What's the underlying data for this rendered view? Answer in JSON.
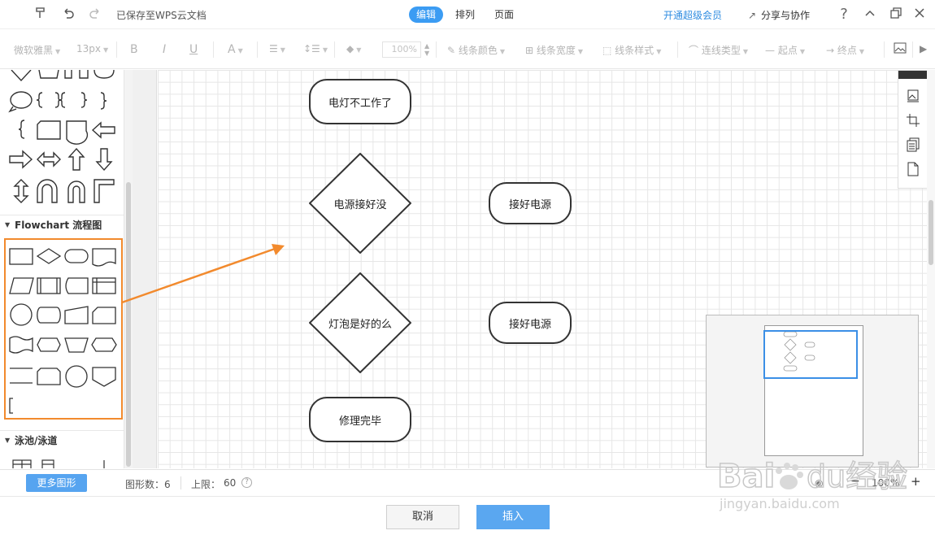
{
  "titlebar": {
    "saved_status": "已保存至WPS云文档",
    "tabs": [
      "编辑",
      "排列",
      "页面"
    ],
    "vip_link": "开通超级会员",
    "share": "分享与协作",
    "help": "?"
  },
  "toolbar": {
    "font_family": "微软雅黑",
    "font_size": "13px",
    "bold": "B",
    "italic": "I",
    "underline": "U",
    "font_color": "A",
    "zoom_value": "100%",
    "line_color": "线条颜色",
    "line_width": "线条宽度",
    "line_style": "线条样式",
    "connector_type": "连线类型",
    "start_point": "起点",
    "end_point": "终点"
  },
  "shape_panel": {
    "flowchart_header": "Flowchart 流程图",
    "swimlane_header": "泳池/泳道"
  },
  "canvas": {
    "nodes": {
      "n1": "电灯不工作了",
      "n2": "电源接好没",
      "n3": "接好电源",
      "n4": "灯泡是好的么",
      "n5": "接好电源",
      "n6": "修理完毕"
    }
  },
  "status": {
    "more_shapes": "更多图形",
    "shape_count_label": "图形数：6",
    "limit_label": "上限：",
    "limit_value": "60",
    "zoom": "100%"
  },
  "footer": {
    "cancel": "取消",
    "insert": "插入"
  },
  "watermark": {
    "brand": "Bai经验",
    "url": "jingyan.baidu.com"
  },
  "colors": {
    "accent": "#3b9cf3",
    "highlight": "#f28a2d",
    "minimap_view": "#3b8fe6"
  }
}
